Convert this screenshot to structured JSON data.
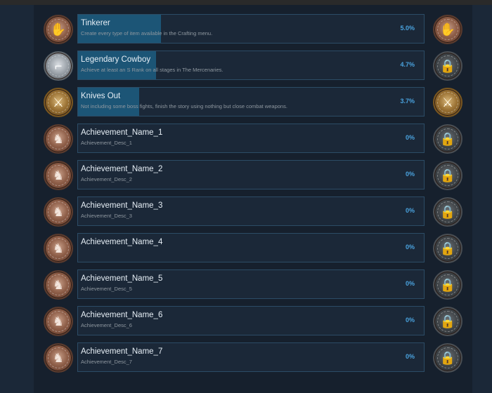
{
  "achievements": [
    {
      "name": "Tinkerer",
      "desc": "Create every type of item available in the Crafting menu.",
      "pct": "5.0%",
      "fill": 0.05,
      "left_badge": "hand-icon",
      "right_badge": "hand-icon",
      "unlocked": true
    },
    {
      "name": "Legendary Cowboy",
      "desc": "Achieve at least an S Rank on all stages in The Mercenaries.",
      "pct": "4.7%",
      "fill": 0.047,
      "left_badge": "revolver-icon",
      "right_badge": "lock-icon",
      "unlocked": false
    },
    {
      "name": "Knives Out",
      "desc": "Not including some boss fights, finish the story using nothing but close combat weapons.",
      "pct": "3.7%",
      "fill": 0.037,
      "left_badge": "knife-icon",
      "right_badge": "knife-icon",
      "unlocked": true
    },
    {
      "name": "Achievement_Name_1",
      "desc": "Achievement_Desc_1",
      "pct": "0%",
      "fill": 0,
      "left_badge": "character-icon",
      "right_badge": "lock-icon",
      "unlocked": false
    },
    {
      "name": "Achievement_Name_2",
      "desc": "Achievement_Desc_2",
      "pct": "0%",
      "fill": 0,
      "left_badge": "character-icon",
      "right_badge": "lock-icon",
      "unlocked": false
    },
    {
      "name": "Achievement_Name_3",
      "desc": "Achievement_Desc_3",
      "pct": "0%",
      "fill": 0,
      "left_badge": "character-icon",
      "right_badge": "lock-icon",
      "unlocked": false
    },
    {
      "name": "Achievement_Name_4",
      "desc": "",
      "pct": "0%",
      "fill": 0,
      "left_badge": "character-icon",
      "right_badge": "lock-icon",
      "unlocked": false
    },
    {
      "name": "Achievement_Name_5",
      "desc": "Achievement_Desc_5",
      "pct": "0%",
      "fill": 0,
      "left_badge": "character-icon",
      "right_badge": "lock-icon",
      "unlocked": false
    },
    {
      "name": "Achievement_Name_6",
      "desc": "Achievement_Desc_6",
      "pct": "0%",
      "fill": 0,
      "left_badge": "character-icon",
      "right_badge": "lock-icon",
      "unlocked": false
    },
    {
      "name": "Achievement_Name_7",
      "desc": "Achievement_Desc_7",
      "pct": "0%",
      "fill": 0,
      "left_badge": "character-icon",
      "right_badge": "lock-icon",
      "unlocked": false
    }
  ],
  "colors": {
    "background": "#1b2838",
    "panel": "#16202d",
    "card_border": "#2c4c66",
    "progress_fill": "#1d5a7d",
    "percent_text": "#4aa3df",
    "title_text": "#e6eef5",
    "desc_text": "#8f98a0"
  }
}
